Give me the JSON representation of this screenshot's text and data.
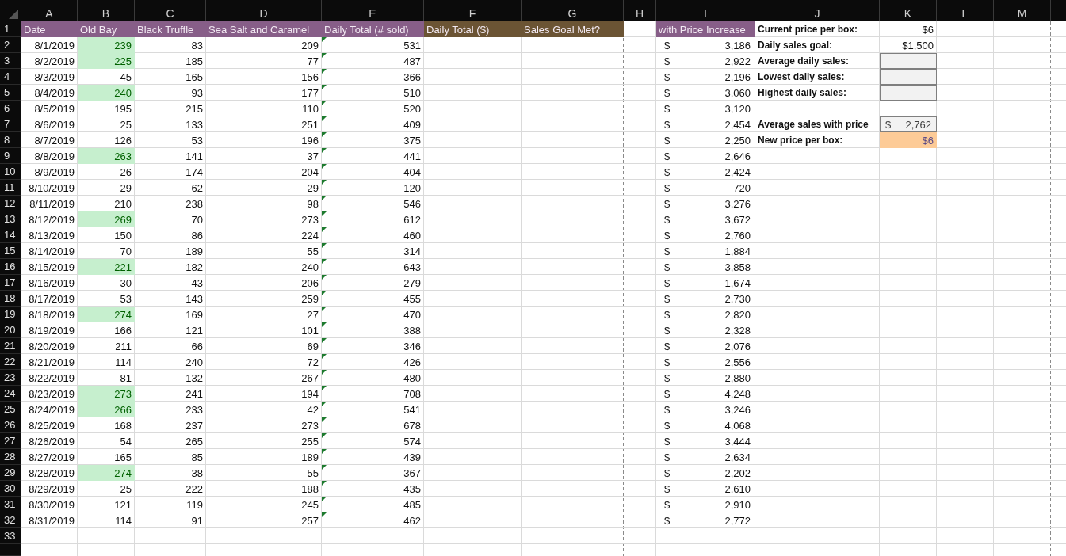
{
  "column_letters": [
    "A",
    "B",
    "C",
    "D",
    "E",
    "F",
    "G",
    "H",
    "I",
    "J",
    "K",
    "L",
    "M"
  ],
  "row_numbers": [
    "1",
    "2",
    "3",
    "4",
    "5",
    "6",
    "7",
    "8",
    "9",
    "10",
    "11",
    "12",
    "13",
    "14",
    "15",
    "16",
    "17",
    "18",
    "19",
    "20",
    "21",
    "22",
    "23",
    "24",
    "25",
    "26",
    "27",
    "28",
    "29",
    "30",
    "31",
    "32",
    "33"
  ],
  "header": {
    "product_columns": [
      {
        "text": "Date",
        "color": "#875e88"
      },
      {
        "text": "Old Bay",
        "color": "#875e88"
      },
      {
        "text": "Black Truffle",
        "color": "#875e88"
      },
      {
        "text": "Sea Salt and Caramel",
        "color": "#875e88"
      },
      {
        "text": "Daily Total (# sold)",
        "color": "#875e88"
      },
      {
        "text": "Daily Total ($)",
        "color": "#6b5434"
      },
      {
        "text": "Sales Goal Met?",
        "color": "#6b5434"
      }
    ],
    "price_increase": {
      "text": "with Price Increase",
      "color": "#875e88"
    }
  },
  "rows": [
    {
      "date": "8/1/2019",
      "old_bay": "239",
      "old_bay_high": true,
      "black_truffle": "83",
      "sea_salt_caramel": "209",
      "daily_total": "531",
      "flagged": true,
      "increase": {
        "currency": "$",
        "amount": "3,186"
      }
    },
    {
      "date": "8/2/2019",
      "old_bay": "225",
      "old_bay_high": true,
      "black_truffle": "185",
      "sea_salt_caramel": "77",
      "daily_total": "487",
      "flagged": true,
      "increase": {
        "currency": "$",
        "amount": "2,922"
      }
    },
    {
      "date": "8/3/2019",
      "old_bay": "45",
      "old_bay_high": false,
      "black_truffle": "165",
      "sea_salt_caramel": "156",
      "daily_total": "366",
      "flagged": true,
      "increase": {
        "currency": "$",
        "amount": "2,196"
      }
    },
    {
      "date": "8/4/2019",
      "old_bay": "240",
      "old_bay_high": true,
      "black_truffle": "93",
      "sea_salt_caramel": "177",
      "daily_total": "510",
      "flagged": true,
      "increase": {
        "currency": "$",
        "amount": "3,060"
      }
    },
    {
      "date": "8/5/2019",
      "old_bay": "195",
      "old_bay_high": false,
      "black_truffle": "215",
      "sea_salt_caramel": "110",
      "daily_total": "520",
      "flagged": true,
      "increase": {
        "currency": "$",
        "amount": "3,120"
      }
    },
    {
      "date": "8/6/2019",
      "old_bay": "25",
      "old_bay_high": false,
      "black_truffle": "133",
      "sea_salt_caramel": "251",
      "daily_total": "409",
      "flagged": true,
      "increase": {
        "currency": "$",
        "amount": "2,454"
      }
    },
    {
      "date": "8/7/2019",
      "old_bay": "126",
      "old_bay_high": false,
      "black_truffle": "53",
      "sea_salt_caramel": "196",
      "daily_total": "375",
      "flagged": true,
      "increase": {
        "currency": "$",
        "amount": "2,250"
      }
    },
    {
      "date": "8/8/2019",
      "old_bay": "263",
      "old_bay_high": true,
      "black_truffle": "141",
      "sea_salt_caramel": "37",
      "daily_total": "441",
      "flagged": true,
      "increase": {
        "currency": "$",
        "amount": "2,646"
      }
    },
    {
      "date": "8/9/2019",
      "old_bay": "26",
      "old_bay_high": false,
      "black_truffle": "174",
      "sea_salt_caramel": "204",
      "daily_total": "404",
      "flagged": true,
      "increase": {
        "currency": "$",
        "amount": "2,424"
      }
    },
    {
      "date": "8/10/2019",
      "old_bay": "29",
      "old_bay_high": false,
      "black_truffle": "62",
      "sea_salt_caramel": "29",
      "daily_total": "120",
      "flagged": true,
      "increase": {
        "currency": "$",
        "amount": "720"
      }
    },
    {
      "date": "8/11/2019",
      "old_bay": "210",
      "old_bay_high": false,
      "black_truffle": "238",
      "sea_salt_caramel": "98",
      "daily_total": "546",
      "flagged": true,
      "increase": {
        "currency": "$",
        "amount": "3,276"
      }
    },
    {
      "date": "8/12/2019",
      "old_bay": "269",
      "old_bay_high": true,
      "black_truffle": "70",
      "sea_salt_caramel": "273",
      "daily_total": "612",
      "flagged": true,
      "increase": {
        "currency": "$",
        "amount": "3,672"
      }
    },
    {
      "date": "8/13/2019",
      "old_bay": "150",
      "old_bay_high": false,
      "black_truffle": "86",
      "sea_salt_caramel": "224",
      "daily_total": "460",
      "flagged": true,
      "increase": {
        "currency": "$",
        "amount": "2,760"
      }
    },
    {
      "date": "8/14/2019",
      "old_bay": "70",
      "old_bay_high": false,
      "black_truffle": "189",
      "sea_salt_caramel": "55",
      "daily_total": "314",
      "flagged": true,
      "increase": {
        "currency": "$",
        "amount": "1,884"
      }
    },
    {
      "date": "8/15/2019",
      "old_bay": "221",
      "old_bay_high": true,
      "black_truffle": "182",
      "sea_salt_caramel": "240",
      "daily_total": "643",
      "flagged": true,
      "increase": {
        "currency": "$",
        "amount": "3,858"
      }
    },
    {
      "date": "8/16/2019",
      "old_bay": "30",
      "old_bay_high": false,
      "black_truffle": "43",
      "sea_salt_caramel": "206",
      "daily_total": "279",
      "flagged": true,
      "increase": {
        "currency": "$",
        "amount": "1,674"
      }
    },
    {
      "date": "8/17/2019",
      "old_bay": "53",
      "old_bay_high": false,
      "black_truffle": "143",
      "sea_salt_caramel": "259",
      "daily_total": "455",
      "flagged": true,
      "increase": {
        "currency": "$",
        "amount": "2,730"
      }
    },
    {
      "date": "8/18/2019",
      "old_bay": "274",
      "old_bay_high": true,
      "black_truffle": "169",
      "sea_salt_caramel": "27",
      "daily_total": "470",
      "flagged": true,
      "increase": {
        "currency": "$",
        "amount": "2,820"
      }
    },
    {
      "date": "8/19/2019",
      "old_bay": "166",
      "old_bay_high": false,
      "black_truffle": "121",
      "sea_salt_caramel": "101",
      "daily_total": "388",
      "flagged": true,
      "increase": {
        "currency": "$",
        "amount": "2,328"
      }
    },
    {
      "date": "8/20/2019",
      "old_bay": "211",
      "old_bay_high": false,
      "black_truffle": "66",
      "sea_salt_caramel": "69",
      "daily_total": "346",
      "flagged": true,
      "increase": {
        "currency": "$",
        "amount": "2,076"
      }
    },
    {
      "date": "8/21/2019",
      "old_bay": "114",
      "old_bay_high": false,
      "black_truffle": "240",
      "sea_salt_caramel": "72",
      "daily_total": "426",
      "flagged": true,
      "increase": {
        "currency": "$",
        "amount": "2,556"
      }
    },
    {
      "date": "8/22/2019",
      "old_bay": "81",
      "old_bay_high": false,
      "black_truffle": "132",
      "sea_salt_caramel": "267",
      "daily_total": "480",
      "flagged": true,
      "increase": {
        "currency": "$",
        "amount": "2,880"
      }
    },
    {
      "date": "8/23/2019",
      "old_bay": "273",
      "old_bay_high": true,
      "black_truffle": "241",
      "sea_salt_caramel": "194",
      "daily_total": "708",
      "flagged": true,
      "increase": {
        "currency": "$",
        "amount": "4,248"
      }
    },
    {
      "date": "8/24/2019",
      "old_bay": "266",
      "old_bay_high": true,
      "black_truffle": "233",
      "sea_salt_caramel": "42",
      "daily_total": "541",
      "flagged": true,
      "increase": {
        "currency": "$",
        "amount": "3,246"
      }
    },
    {
      "date": "8/25/2019",
      "old_bay": "168",
      "old_bay_high": false,
      "black_truffle": "237",
      "sea_salt_caramel": "273",
      "daily_total": "678",
      "flagged": true,
      "increase": {
        "currency": "$",
        "amount": "4,068"
      }
    },
    {
      "date": "8/26/2019",
      "old_bay": "54",
      "old_bay_high": false,
      "black_truffle": "265",
      "sea_salt_caramel": "255",
      "daily_total": "574",
      "flagged": true,
      "increase": {
        "currency": "$",
        "amount": "3,444"
      }
    },
    {
      "date": "8/27/2019",
      "old_bay": "165",
      "old_bay_high": false,
      "black_truffle": "85",
      "sea_salt_caramel": "189",
      "daily_total": "439",
      "flagged": true,
      "increase": {
        "currency": "$",
        "amount": "2,634"
      }
    },
    {
      "date": "8/28/2019",
      "old_bay": "274",
      "old_bay_high": true,
      "black_truffle": "38",
      "sea_salt_caramel": "55",
      "daily_total": "367",
      "flagged": true,
      "increase": {
        "currency": "$",
        "amount": "2,202"
      }
    },
    {
      "date": "8/29/2019",
      "old_bay": "25",
      "old_bay_high": false,
      "black_truffle": "222",
      "sea_salt_caramel": "188",
      "daily_total": "435",
      "flagged": true,
      "increase": {
        "currency": "$",
        "amount": "2,610"
      }
    },
    {
      "date": "8/30/2019",
      "old_bay": "121",
      "old_bay_high": false,
      "black_truffle": "119",
      "sea_salt_caramel": "245",
      "daily_total": "485",
      "flagged": true,
      "increase": {
        "currency": "$",
        "amount": "2,910"
      }
    },
    {
      "date": "8/31/2019",
      "old_bay": "114",
      "old_bay_high": false,
      "black_truffle": "91",
      "sea_salt_caramel": "257",
      "daily_total": "462",
      "flagged": true,
      "increase": {
        "currency": "$",
        "amount": "2,772"
      }
    }
  ],
  "summary": [
    {
      "kind": "plain",
      "label": "Current price per box:",
      "value": "$6"
    },
    {
      "kind": "plain",
      "label": "Daily sales goal:",
      "value": "$1,500"
    },
    {
      "kind": "input",
      "label": "Average daily sales:"
    },
    {
      "kind": "input",
      "label": "Lowest daily sales:"
    },
    {
      "kind": "input",
      "label": "Highest daily sales:"
    },
    {
      "kind": "blank"
    },
    {
      "kind": "accounting",
      "label": "Average sales with price",
      "currency": "$",
      "value": "2,762"
    },
    {
      "kind": "highlight",
      "label": "New price per box:",
      "value": "$6"
    }
  ]
}
